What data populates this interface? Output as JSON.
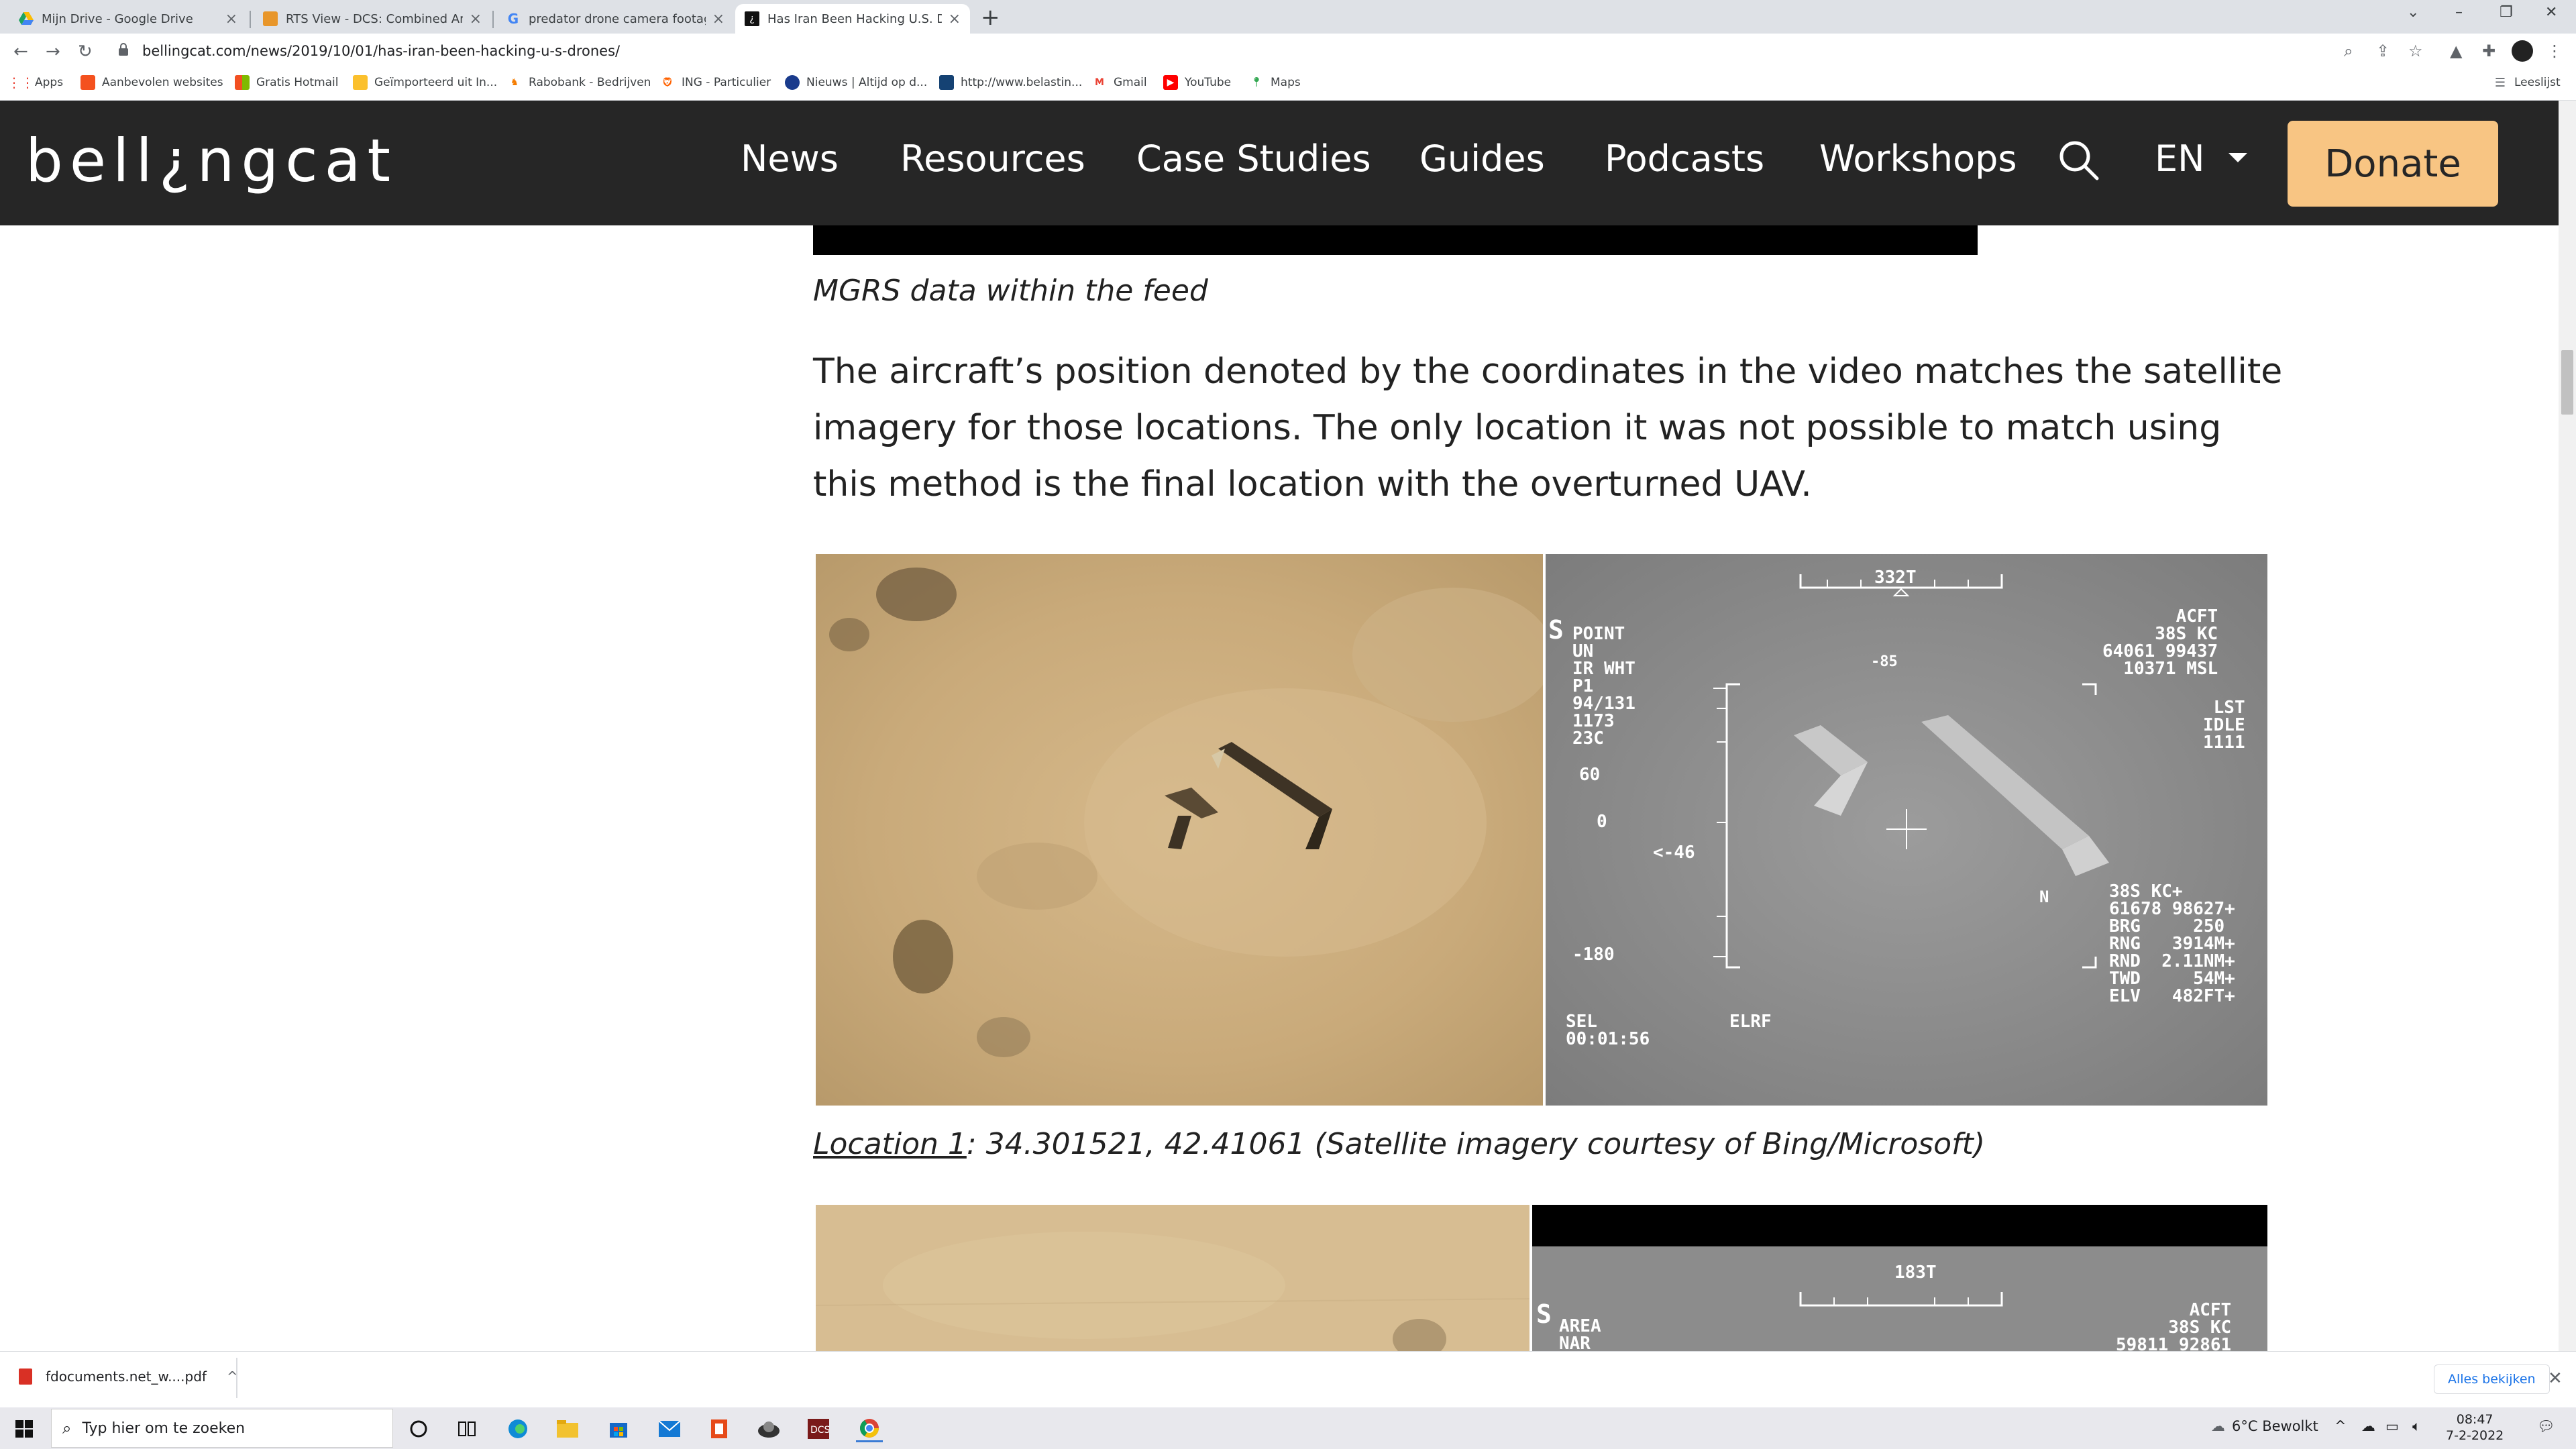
{
  "browser": {
    "tabs": [
      {
        "title": "Mijn Drive - Google Drive",
        "close": "×"
      },
      {
        "title": "RTS View - DCS: Combined Arms",
        "close": "×"
      },
      {
        "title": "predator drone camera footage",
        "close": "×"
      },
      {
        "title": "Has Iran Been Hacking U.S. Drones",
        "close": "×"
      }
    ],
    "new_tab": "+",
    "url": "bellingcat.com/news/2019/10/01/has-iran-been-hacking-u-s-drones/",
    "bookmarks": [
      "Apps",
      "Aanbevolen websites",
      "Gratis Hotmail",
      "Geïmporteerd uit In...",
      "Rabobank - Bedrijven",
      "ING - Particulier",
      "Nieuws | Altijd op d...",
      "http://www.belastin...",
      "Gmail",
      "YouTube",
      "Maps"
    ],
    "reading_list": "Leeslijst"
  },
  "site": {
    "logo": "bell¿ngcat",
    "nav": [
      "News",
      "Resources",
      "Case Studies",
      "Guides",
      "Podcasts",
      "Workshops"
    ],
    "lang": "EN",
    "donate": "Donate"
  },
  "article": {
    "caption_mgrs": "MGRS data within the feed",
    "paragraph": "The aircraft’s position denoted by the coordinates in the video matches the satellite imagery for those locations. The only location it was not possible to match using this method is the final location with the overturned UAV.",
    "caption_loc_link": "Location 1",
    "caption_loc_rest": ": 34.301521, 42.41061 (Satellite imagery courtesy of Bing/Microsoft)",
    "ir1": {
      "heading_top": "332T",
      "heading_sub": "-85",
      "left_block": "POINT\nUN\nIR WHT\nP1\n94/131\n1173\n23C",
      "right_block": "ACFT\n38S KC\n64061 99437\n10371 MSL",
      "right_block2": "LST\nIDLE\n1111",
      "scale_top": "60",
      "scale_zero": "0",
      "scale_arrow": "<-46",
      "scale_bottom": "-180",
      "target_block": "38S KC+\n61678 98627+\nBRG     250\nRNG   3914M+\nRND  2.11NM+\nTWD     54M+\nELV   482FT+",
      "sel_block": "SEL\n00:01:56",
      "elrf": "ELRF",
      "north": "N",
      "s_mark": "S"
    },
    "ir2": {
      "heading_top": "183T",
      "left_block": "AREA\nNAR",
      "right_block": "ACFT\n38S KC\n59811 92861",
      "s_mark": "S"
    }
  },
  "downloads": {
    "file": "fdocuments.net_w....pdf",
    "view_all": "Alles bekijken"
  },
  "taskbar": {
    "search_placeholder": "Typ hier om te zoeken",
    "weather": "6°C  Bewolkt",
    "time": "08:47",
    "date": "7-2-2022"
  },
  "colors": {
    "header_bg": "#262626",
    "donate_bg": "#f8c583",
    "tab_bar": "#dee1e6"
  }
}
